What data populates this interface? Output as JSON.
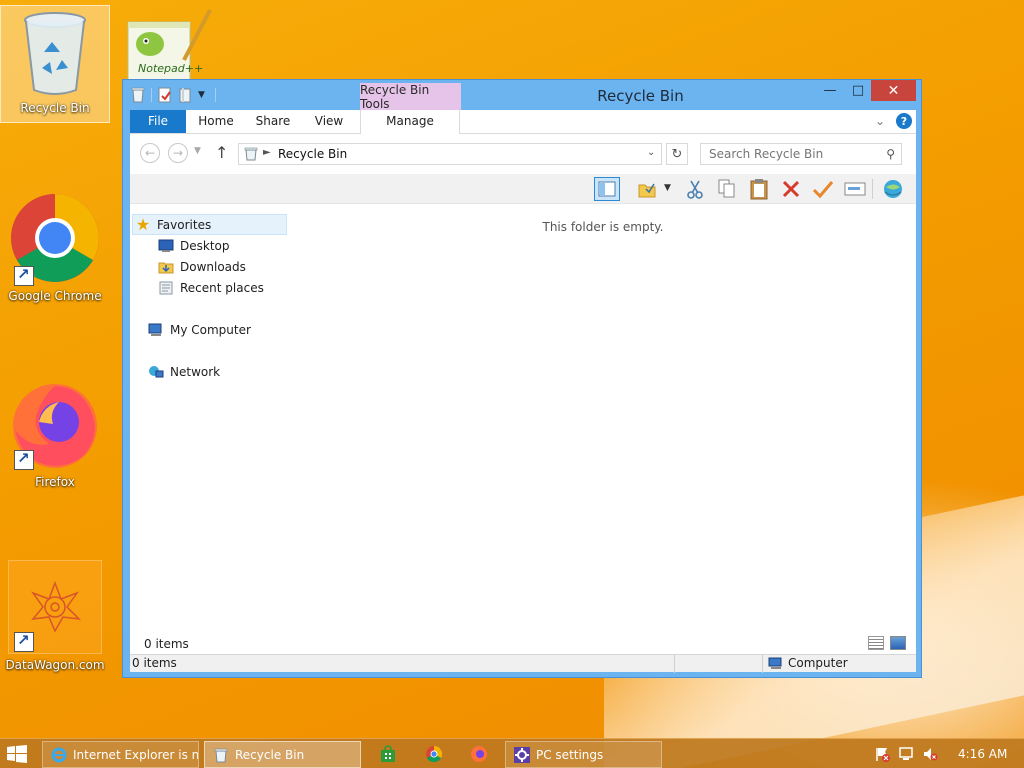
{
  "desktop": {
    "icons": [
      {
        "label": "Recycle Bin"
      },
      {
        "label": "Google Chrome"
      },
      {
        "label": "Firefox"
      },
      {
        "label": "DataWagon.com"
      }
    ],
    "notepad_logo_text": "Notepad++"
  },
  "window": {
    "title": "Recycle Bin",
    "contextual_tab_group": "Recycle Bin Tools",
    "tabs": {
      "file": "File",
      "home": "Home",
      "share": "Share",
      "view": "View",
      "manage": "Manage"
    },
    "controls": {
      "minimize": "—",
      "maximize": "□",
      "close": "✕"
    },
    "help": "?",
    "address": {
      "path": "Recycle Bin"
    },
    "search": {
      "placeholder": "Search Recycle Bin"
    },
    "nav_pane": {
      "favorites": "Favorites",
      "items": [
        "Desktop",
        "Downloads",
        "Recent places"
      ],
      "my_computer": "My Computer",
      "network": "Network"
    },
    "content": {
      "empty_message": "This folder is empty."
    },
    "item_count": "0 items",
    "status": {
      "items": "0 items",
      "location": "Computer"
    }
  },
  "taskbar": {
    "tasks": [
      {
        "label": "Internet Explorer is n...",
        "active": false
      },
      {
        "label": "Recycle Bin",
        "active": true
      },
      {
        "label": "PC settings",
        "active": false
      }
    ],
    "clock": "4:16 AM"
  },
  "colors": {
    "accent": "#1979ca",
    "window_frame": "#6cb4f0",
    "contextual_tab": "#e6c3e9",
    "close_button": "#c7453c",
    "wallpaper": "#f6a400"
  }
}
